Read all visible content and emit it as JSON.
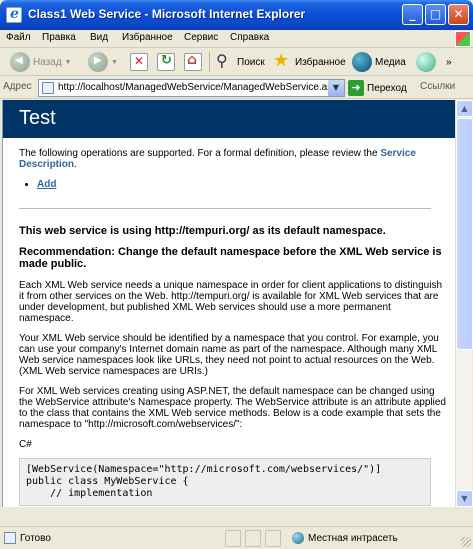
{
  "window": {
    "title": "Class1 Web Service - Microsoft Internet Explorer",
    "min": "_",
    "max": "□",
    "close": "✕"
  },
  "menu": [
    "Файл",
    "Правка",
    "Вид",
    "Избранное",
    "Сервис",
    "Справка"
  ],
  "toolbar": {
    "back_label": "Назад",
    "search_label": "Поиск",
    "favorites_label": "Избранное",
    "media_label": "Медиа"
  },
  "address": {
    "label": "Адрес",
    "url": "http://localhost/ManagedWebService/ManagedWebService.asmx",
    "go_label": "Переход",
    "links_label": "Ссылки"
  },
  "page": {
    "banner_title": "Test",
    "intro_text": "The following operations are supported. For a formal definition, please review the ",
    "service_description_link": "Service Description",
    "intro_end": ".",
    "operations": [
      "Add"
    ],
    "namespace_heading": "This web service is using http://tempuri.org/ as its default namespace.",
    "recommendation_heading": "Recommendation: Change the default namespace before the XML Web service is made public.",
    "para1": "Each XML Web service needs a unique namespace in order for client applications to distinguish it from other services on the Web. http://tempuri.org/ is available for XML Web services that are under development, but published XML Web services should use a more permanent namespace.",
    "para2": "Your XML Web service should be identified by a namespace that you control. For example, you can use your company's Internet domain name as part of the namespace. Although many XML Web service namespaces look like URLs, they need not point to actual resources on the Web. (XML Web service namespaces are URIs.)",
    "para3": "For XML Web services creating using ASP.NET, the default namespace can be changed using the WebService attribute's Namespace property. The WebService attribute is an attribute applied to the class that contains the XML Web service methods. Below is a code example that sets the namespace to \"http://microsoft.com/webservices/\":",
    "lang_label": "C#",
    "code": "[WebService(Namespace=\"http://microsoft.com/webservices/\")]\npublic class MyWebService {\n    // implementation"
  },
  "status": {
    "done": "Готово",
    "zone": "Местная интрасеть"
  }
}
